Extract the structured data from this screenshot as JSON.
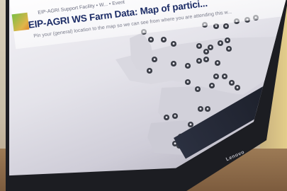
{
  "page": {
    "breadcrumb": "EIP-AGRI Support Facility  •  W...  •  Event",
    "title": "EIP-AGRI WS Farm Data: Map of partici...",
    "subtitle": "Pin your (general) location to the map so we can see from where you are attending this w..."
  },
  "device": {
    "brand": "Lenovo"
  },
  "map": {
    "marker_color": "#3a3d46",
    "marker_icon": "map-pin-icon"
  },
  "colors": {
    "title": "#1c2c66",
    "screen": "#e6e5ec",
    "bezel": "#1c1d22",
    "desk": "#8a6a48",
    "wall": "#d8c48a"
  }
}
